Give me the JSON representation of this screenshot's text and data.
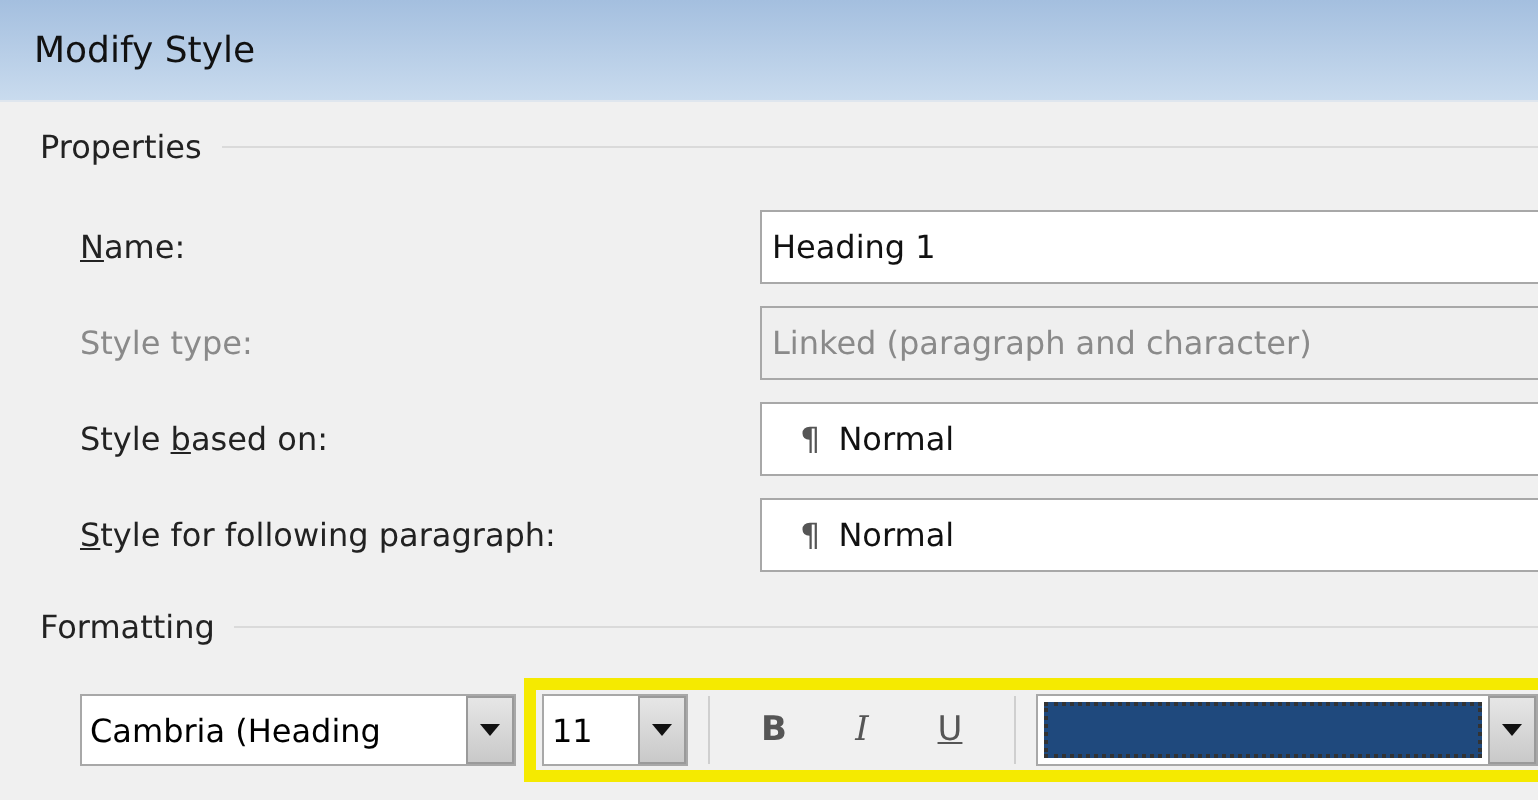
{
  "window": {
    "title": "Modify Style"
  },
  "properties": {
    "heading": "Properties",
    "rows": [
      {
        "label": [
          {
            "text": "N",
            "underlined": true
          },
          {
            "text": "ame:",
            "underlined": false
          }
        ],
        "kind": "text",
        "value": "Heading 1",
        "disabled": false
      },
      {
        "label": [
          {
            "text": "Style type:",
            "underlined": false
          }
        ],
        "kind": "text",
        "value": "Linked (paragraph and character)",
        "disabled": true
      },
      {
        "label": [
          {
            "text": "Style ",
            "underlined": false
          },
          {
            "text": "b",
            "underlined": true
          },
          {
            "text": "ased on:",
            "underlined": false
          }
        ],
        "kind": "style",
        "pilcrow": "¶",
        "value": "Normal",
        "disabled": false
      },
      {
        "label": [
          {
            "text": "S",
            "underlined": true
          },
          {
            "text": "tyle for following paragraph:",
            "underlined": false
          }
        ],
        "kind": "style",
        "pilcrow": "¶",
        "value": "Normal",
        "disabled": false
      }
    ]
  },
  "formatting": {
    "heading": "Formatting",
    "font": "Cambria (Heading",
    "highlighted": true,
    "size": "11",
    "bold": "B",
    "italic": "I",
    "underline": "U",
    "font_color": {
      "color": "#1f497d"
    }
  }
}
